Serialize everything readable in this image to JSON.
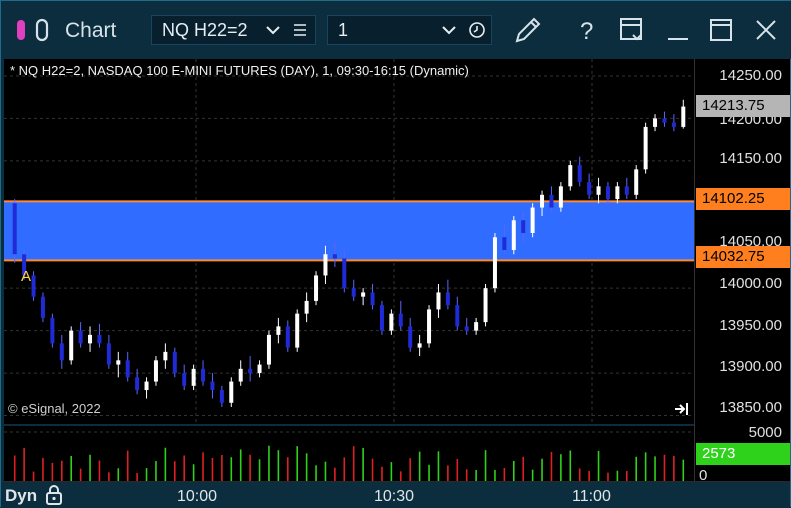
{
  "window": {
    "title": "Chart",
    "symbol": "NQ H22=2",
    "interval": "1",
    "colors": {
      "frame": "#0c2d3e",
      "band": "#2f6cff",
      "band_border": "#ff8a33",
      "up": "#ffffff",
      "down": "#1e2bd6"
    }
  },
  "chart": {
    "header": "* NQ H22=2, NASDAQ 100 E-MINI FUTURES (DAY), 1, 09:30-16:15 (Dynamic)",
    "copyright": "© eSignal, 2022",
    "marker": "A",
    "price_labels": [
      "14250.00",
      "14200.00",
      "14150.00",
      "14050.00",
      "14000.00",
      "13950.00",
      "13900.00",
      "13850.00"
    ],
    "badges": {
      "last": "14213.75",
      "upper": "14102.25",
      "lower": "14032.75",
      "volume_last": "2573"
    },
    "volume_labels": [
      "5000",
      "0"
    ],
    "time_labels": [
      "10:00",
      "10:30",
      "11:00"
    ],
    "footer_label": "Dyn"
  },
  "chart_data": {
    "type": "candlestick",
    "ylim": [
      13840,
      14270
    ],
    "band": [
      14032.75,
      14102.25
    ],
    "last": 14213.75,
    "candles": [
      {
        "o": 14100,
        "h": 14105,
        "l": 14030,
        "c": 14040
      },
      {
        "o": 14040,
        "h": 14045,
        "l": 14010,
        "c": 14015
      },
      {
        "o": 14015,
        "h": 14020,
        "l": 13985,
        "c": 13990
      },
      {
        "o": 13990,
        "h": 13995,
        "l": 13960,
        "c": 13965
      },
      {
        "o": 13965,
        "h": 13970,
        "l": 13930,
        "c": 13935
      },
      {
        "o": 13935,
        "h": 13945,
        "l": 13905,
        "c": 13915
      },
      {
        "o": 13915,
        "h": 13955,
        "l": 13910,
        "c": 13950
      },
      {
        "o": 13950,
        "h": 13960,
        "l": 13930,
        "c": 13935
      },
      {
        "o": 13935,
        "h": 13955,
        "l": 13925,
        "c": 13945
      },
      {
        "o": 13945,
        "h": 13958,
        "l": 13930,
        "c": 13935
      },
      {
        "o": 13935,
        "h": 13945,
        "l": 13905,
        "c": 13910
      },
      {
        "o": 13910,
        "h": 13925,
        "l": 13895,
        "c": 13915
      },
      {
        "o": 13915,
        "h": 13925,
        "l": 13890,
        "c": 13895
      },
      {
        "o": 13895,
        "h": 13905,
        "l": 13875,
        "c": 13880
      },
      {
        "o": 13880,
        "h": 13895,
        "l": 13870,
        "c": 13890
      },
      {
        "o": 13890,
        "h": 13920,
        "l": 13885,
        "c": 13915
      },
      {
        "o": 13915,
        "h": 13935,
        "l": 13905,
        "c": 13925
      },
      {
        "o": 13925,
        "h": 13930,
        "l": 13895,
        "c": 13900
      },
      {
        "o": 13900,
        "h": 13910,
        "l": 13880,
        "c": 13885
      },
      {
        "o": 13885,
        "h": 13910,
        "l": 13880,
        "c": 13905
      },
      {
        "o": 13905,
        "h": 13915,
        "l": 13885,
        "c": 13890
      },
      {
        "o": 13890,
        "h": 13900,
        "l": 13870,
        "c": 13880
      },
      {
        "o": 13880,
        "h": 13885,
        "l": 13860,
        "c": 13865
      },
      {
        "o": 13865,
        "h": 13895,
        "l": 13860,
        "c": 13890
      },
      {
        "o": 13890,
        "h": 13915,
        "l": 13885,
        "c": 13905
      },
      {
        "o": 13905,
        "h": 13920,
        "l": 13890,
        "c": 13900
      },
      {
        "o": 13900,
        "h": 13915,
        "l": 13895,
        "c": 13910
      },
      {
        "o": 13910,
        "h": 13950,
        "l": 13905,
        "c": 13945
      },
      {
        "o": 13945,
        "h": 13965,
        "l": 13935,
        "c": 13955
      },
      {
        "o": 13955,
        "h": 13962,
        "l": 13925,
        "c": 13930
      },
      {
        "o": 13930,
        "h": 13975,
        "l": 13925,
        "c": 13970
      },
      {
        "o": 13970,
        "h": 13995,
        "l": 13960,
        "c": 13985
      },
      {
        "o": 13985,
        "h": 14020,
        "l": 13980,
        "c": 14015
      },
      {
        "o": 14015,
        "h": 14050,
        "l": 14005,
        "c": 14040
      },
      {
        "o": 14040,
        "h": 14055,
        "l": 14025,
        "c": 14035
      },
      {
        "o": 14035,
        "h": 14045,
        "l": 13995,
        "c": 14000
      },
      {
        "o": 14000,
        "h": 14010,
        "l": 13985,
        "c": 13990
      },
      {
        "o": 13990,
        "h": 14000,
        "l": 13980,
        "c": 13995
      },
      {
        "o": 13995,
        "h": 14005,
        "l": 13975,
        "c": 13980
      },
      {
        "o": 13980,
        "h": 13985,
        "l": 13945,
        "c": 13950
      },
      {
        "o": 13950,
        "h": 13975,
        "l": 13945,
        "c": 13970
      },
      {
        "o": 13970,
        "h": 13985,
        "l": 13950,
        "c": 13955
      },
      {
        "o": 13955,
        "h": 13965,
        "l": 13925,
        "c": 13930
      },
      {
        "o": 13930,
        "h": 13945,
        "l": 13920,
        "c": 13935
      },
      {
        "o": 13935,
        "h": 13980,
        "l": 13930,
        "c": 13975
      },
      {
        "o": 13975,
        "h": 14005,
        "l": 13965,
        "c": 13995
      },
      {
        "o": 13995,
        "h": 14010,
        "l": 13975,
        "c": 13980
      },
      {
        "o": 13980,
        "h": 13990,
        "l": 13950,
        "c": 13955
      },
      {
        "o": 13955,
        "h": 13965,
        "l": 13945,
        "c": 13950
      },
      {
        "o": 13950,
        "h": 13965,
        "l": 13945,
        "c": 13960
      },
      {
        "o": 13960,
        "h": 14005,
        "l": 13955,
        "c": 14000
      },
      {
        "o": 14000,
        "h": 14065,
        "l": 13995,
        "c": 14060
      },
      {
        "o": 14060,
        "h": 14075,
        "l": 14040,
        "c": 14045
      },
      {
        "o": 14045,
        "h": 14085,
        "l": 14040,
        "c": 14080
      },
      {
        "o": 14080,
        "h": 14090,
        "l": 14055,
        "c": 14065
      },
      {
        "o": 14065,
        "h": 14100,
        "l": 14060,
        "c": 14095
      },
      {
        "o": 14095,
        "h": 14115,
        "l": 14085,
        "c": 14110
      },
      {
        "o": 14110,
        "h": 14120,
        "l": 14090,
        "c": 14095
      },
      {
        "o": 14095,
        "h": 14125,
        "l": 14090,
        "c": 14120
      },
      {
        "o": 14120,
        "h": 14150,
        "l": 14115,
        "c": 14145
      },
      {
        "o": 14145,
        "h": 14155,
        "l": 14120,
        "c": 14125
      },
      {
        "o": 14125,
        "h": 14135,
        "l": 14105,
        "c": 14110
      },
      {
        "o": 14110,
        "h": 14130,
        "l": 14100,
        "c": 14120
      },
      {
        "o": 14120,
        "h": 14125,
        "l": 14098,
        "c": 14105
      },
      {
        "o": 14105,
        "h": 14125,
        "l": 14100,
        "c": 14120
      },
      {
        "o": 14120,
        "h": 14130,
        "l": 14105,
        "c": 14110
      },
      {
        "o": 14110,
        "h": 14145,
        "l": 14105,
        "c": 14140
      },
      {
        "o": 14140,
        "h": 14195,
        "l": 14135,
        "c": 14190
      },
      {
        "o": 14190,
        "h": 14205,
        "l": 14185,
        "c": 14200
      },
      {
        "o": 14200,
        "h": 14208,
        "l": 14190,
        "c": 14195
      },
      {
        "o": 14195,
        "h": 14205,
        "l": 14185,
        "c": 14190
      },
      {
        "o": 14190,
        "h": 14222,
        "l": 14188,
        "c": 14214
      }
    ],
    "volume_scale": [
      0,
      5000
    ],
    "volume_last": 2573
  }
}
